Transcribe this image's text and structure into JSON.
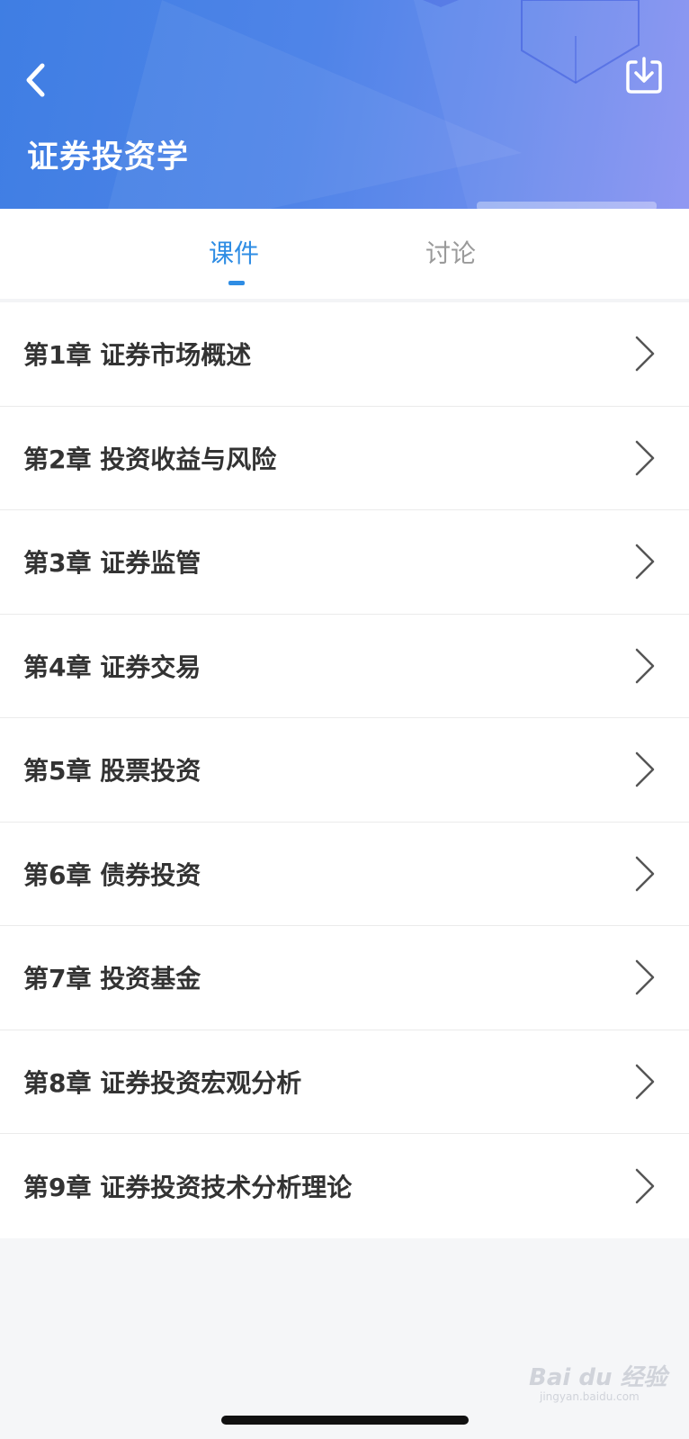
{
  "header": {
    "title": "证券投资学",
    "back_icon": "chevron-left-icon",
    "download_icon": "download-icon",
    "gradient_colors": [
      "#3f7ee3",
      "#8a93f2"
    ]
  },
  "tabs": [
    {
      "label": "课件",
      "active": true
    },
    {
      "label": "讨论",
      "active": false
    }
  ],
  "accent_color": "#2f8de4",
  "chapters": [
    {
      "label": "第1章 证券市场概述"
    },
    {
      "label": "第2章 投资收益与风险"
    },
    {
      "label": "第3章 证券监管"
    },
    {
      "label": "第4章 证券交易"
    },
    {
      "label": "第5章 股票投资"
    },
    {
      "label": "第6章 债券投资"
    },
    {
      "label": "第7章 投资基金"
    },
    {
      "label": "第8章 证券投资宏观分析"
    },
    {
      "label": "第9章 证券投资技术分析理论"
    }
  ],
  "watermark": {
    "text": "Bai du 经验",
    "sub": "jingyan.baidu.com"
  }
}
